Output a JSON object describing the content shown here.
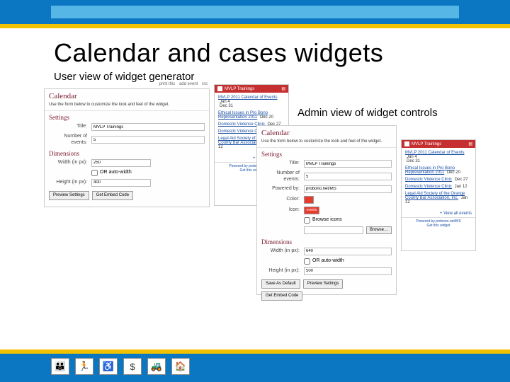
{
  "slide": {
    "title": "Calendar and cases widgets",
    "user_caption": "User view of widget generator",
    "admin_caption": "Admin view of widget controls"
  },
  "user": {
    "toolbar": {
      "print": "print this",
      "add": "add event",
      "rss": "rss"
    },
    "heading": "Calendar",
    "desc": "Use the form below to customize the look and feel of the widget.",
    "sections": {
      "settings": "Settings",
      "dimensions": "Dimensions"
    },
    "labels": {
      "title": "Title:",
      "num_events": "Number of events:",
      "width": "Width (in px):",
      "autowidth": "OR auto-width",
      "height": "Height (in px):"
    },
    "values": {
      "title": "MVLP Trainings",
      "num_events": "5",
      "width": "250",
      "height": "400"
    },
    "buttons": {
      "preview": "Preview Settings",
      "embed": "Get Embed Code"
    }
  },
  "admin": {
    "heading": "Calendar",
    "desc": "Use the form below to customize the look and feel of the widget.",
    "sections": {
      "settings": "Settings",
      "dimensions": "Dimensions"
    },
    "labels": {
      "title": "Title:",
      "num_events": "Number of events:",
      "powered": "Powered by:",
      "color": "Color:",
      "icon": "Icon:",
      "width": "Width (in px):",
      "autowidth": "OR auto-width",
      "height": "Height (in px):"
    },
    "values": {
      "title": "MVLP Trainings",
      "num_events": "5",
      "powered": "probono.net/MS",
      "icon": "events",
      "icon_display": "Browse icons",
      "browse": "Browse…",
      "width": "640",
      "height": "500"
    },
    "buttons": {
      "save": "Save As Default",
      "preview": "Preview Settings",
      "embed": "Get Embed Code"
    }
  },
  "preview": {
    "header": "MVLP Trainings",
    "events": [
      {
        "title": "MVLP 2011 Calendar of Events",
        "date": "Jan 4",
        "sub": "Dec 31"
      },
      {
        "title": "Ethical Issues in Pro Bono Representation 2011",
        "date": "Dec 20"
      },
      {
        "title": "Domestic Violence Clinic",
        "date": "Dec 27"
      },
      {
        "title": "Domestic Violence Clinic",
        "date": "Jan 12"
      },
      {
        "title": "Legal Aid Society of the Orange County Bar Association, Inc.",
        "date": "Jan 12"
      }
    ],
    "more": "+ View all events",
    "footer1": "Powered by probono.net/MS",
    "footer2": "Get this widget"
  },
  "footer_icons": [
    "family-icon",
    "running-icon",
    "accessibility-icon",
    "dollar-icon",
    "tractor-icon",
    "house-icon"
  ],
  "glyphs": {
    "family-icon": "👪",
    "running-icon": "🏃",
    "accessibility-icon": "♿",
    "dollar-icon": "$",
    "tractor-icon": "🚜",
    "house-icon": "🏠"
  }
}
